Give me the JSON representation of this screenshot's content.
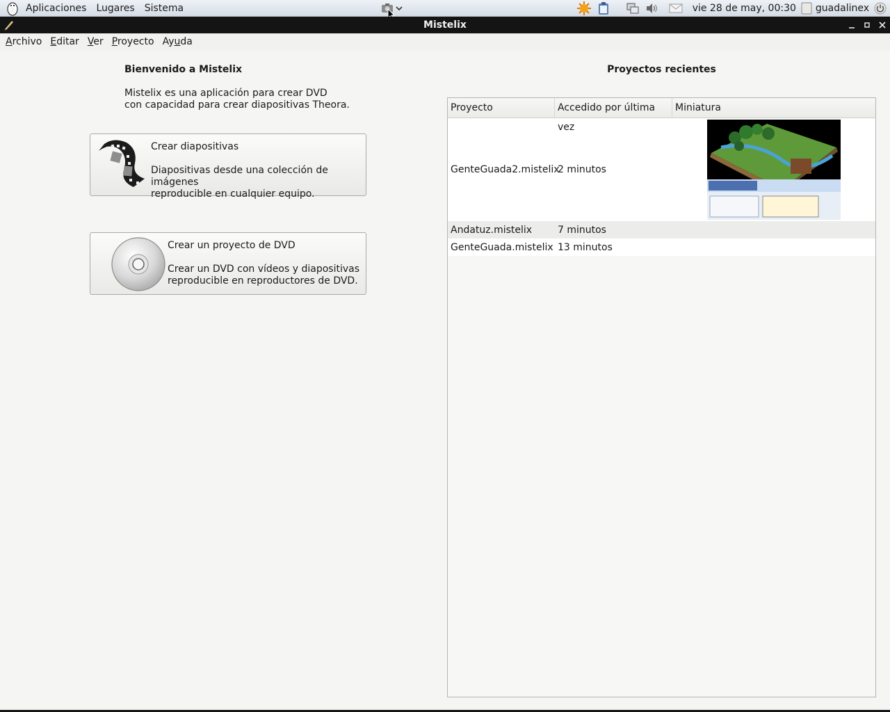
{
  "panel": {
    "menus": [
      "Aplicaciones",
      "Lugares",
      "Sistema"
    ],
    "clock": "vie 28 de may, 00:30",
    "user": "guadalinex"
  },
  "window": {
    "title": "Mistelix"
  },
  "menubar": [
    {
      "mnemonic": "A",
      "rest": "rchivo"
    },
    {
      "mnemonic": "E",
      "rest": "ditar"
    },
    {
      "mnemonic": "V",
      "rest": "er"
    },
    {
      "mnemonic": "P",
      "rest": "royecto"
    },
    {
      "pre": "Ay",
      "mnemonic": "u",
      "rest": "da"
    }
  ],
  "welcome": {
    "title": "Bienvenido a Mistelix",
    "desc_line1": "Mistelix es una aplicación para crear DVD",
    "desc_line2": "con capacidad para crear diapositivas Theora."
  },
  "actions": {
    "slides": {
      "title": "Crear diapositivas",
      "desc_line1": "Diapositivas desde una colección de imágenes",
      "desc_line2": "reproducible en cualquier equipo.",
      "icon": "film-strip-icon"
    },
    "dvd": {
      "title": "Crear un proyecto de DVD",
      "desc_line1": "Crear un DVD con vídeos y diapositivas",
      "desc_line2": "reproducible en reproductores de DVD.",
      "icon": "dvd-disc-icon"
    }
  },
  "recent": {
    "title": "Proyectos recientes",
    "columns": [
      "Proyecto",
      "Accedido por última vez",
      "Miniatura"
    ],
    "rows": [
      {
        "project": "GenteGuada2.mistelix",
        "accessed": "2 minutos",
        "has_thumbnail": true
      },
      {
        "project": "Andatuz.mistelix",
        "accessed": "7 minutos",
        "has_thumbnail": false
      },
      {
        "project": "GenteGuada.mistelix",
        "accessed": "13 minutos",
        "has_thumbnail": false
      }
    ]
  },
  "colors": {
    "titlebar": "#141414",
    "panel": "#dde3ea",
    "background": "#f5f5f4"
  }
}
